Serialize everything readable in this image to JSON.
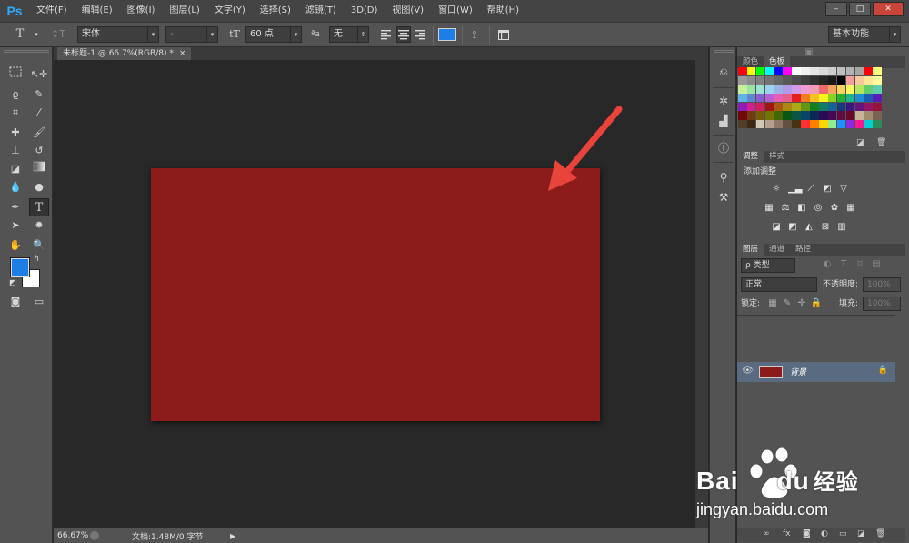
{
  "app": {
    "logo": "Ps"
  },
  "menu": [
    "文件(F)",
    "编辑(E)",
    "图像(I)",
    "图层(L)",
    "文字(Y)",
    "选择(S)",
    "滤镜(T)",
    "3D(D)",
    "视图(V)",
    "窗口(W)",
    "帮助(H)"
  ],
  "window_controls": {
    "minimize": "–",
    "maximize": "□",
    "close": "✕"
  },
  "options": {
    "tool_glyph": "T",
    "font_family": "宋体",
    "font_style": "-",
    "font_size": "60 点",
    "aa_label": "ªa",
    "antialias": "无",
    "text_color": "#1e7ee6",
    "workspace": "基本功能"
  },
  "document": {
    "tab_title": "未标题-1 @ 66.7%(RGB/8) *",
    "tab_close": "×",
    "canvas_color": "#8c1c1c",
    "arrow_color": "#e8443c"
  },
  "status": {
    "zoom": "66.67%",
    "doc_info": "文档:1.48M/0 字节"
  },
  "colors": {
    "foreground": "#1e7ee6",
    "background": "#ffffff"
  },
  "panels": {
    "swatch_tabs": [
      "颜色",
      "色板"
    ],
    "adjust_tabs": [
      "调整",
      "样式"
    ],
    "adjust_title": "添加调整",
    "layer_tabs": [
      "图层",
      "通道",
      "路径"
    ],
    "filter_kind": "ρ 类型",
    "blend_mode": "正常",
    "opacity_label": "不透明度:",
    "opacity_value": "100%",
    "lock_label": "锁定:",
    "fill_label": "填充:",
    "fill_value": "100%",
    "layer_name": "背景",
    "layer_color": "#8c1c1c"
  },
  "swatches": [
    "#ff0000",
    "#ffff00",
    "#00ff00",
    "#00ffff",
    "#0000ff",
    "#ff00ff",
    "#ffffff",
    "#f2f2f2",
    "#e6e6e6",
    "#d9d9d9",
    "#cccccc",
    "#bfbfbf",
    "#b3b3b3",
    "#a6a6a6",
    "#ff0000",
    "#ffff80",
    "#999999",
    "#8c8c8c",
    "#808080",
    "#737373",
    "#666666",
    "#595959",
    "#4d4d4d",
    "#404040",
    "#333333",
    "#262626",
    "#1a1a1a",
    "#000000",
    "#f4a0a0",
    "#f8c89a",
    "#fde59a",
    "#fdfc9a",
    "#c8f09a",
    "#9ae6a0",
    "#9ae6d2",
    "#9ad2f0",
    "#9ab4e6",
    "#b49ae6",
    "#d29ae6",
    "#f09ad2",
    "#f09ab4",
    "#ed6b6b",
    "#f4a65f",
    "#fbd15f",
    "#fbf95f",
    "#b4e65f",
    "#5fcd6b",
    "#5fcdb4",
    "#5fb4e6",
    "#5f87d2",
    "#875fd2",
    "#b45fd2",
    "#e65fb4",
    "#e65f87",
    "#e61e1e",
    "#ef7d1e",
    "#f7c11e",
    "#f7f41e",
    "#8dd21e",
    "#1eb42d",
    "#1eb48d",
    "#1e8dd2",
    "#1e5ab4",
    "#5a1eb4",
    "#8d1eb4",
    "#d21e8d",
    "#d21e5a",
    "#a01414",
    "#a85a14",
    "#ad8714",
    "#ada914",
    "#649614",
    "#147d1e",
    "#147d64",
    "#146496",
    "#143c7d",
    "#3c147d",
    "#64147d",
    "#961464",
    "#96143c",
    "#6e0a0a",
    "#733c0a",
    "#765c0a",
    "#767400",
    "#446605",
    "#0a5514",
    "#0a5544",
    "#0a4466",
    "#0a2855",
    "#280a55",
    "#440a55",
    "#660a44",
    "#660a28",
    "#c8b496",
    "#a08c6e",
    "#786450",
    "#503c28",
    "#3c2814",
    "#d2c8b4",
    "#b4a08c",
    "#8c7864",
    "#645040",
    "#463214",
    "#ff3030",
    "#ff8000",
    "#ffd700",
    "#90ee90",
    "#1e90ff",
    "#8a2be2",
    "#ff1493",
    "#00ced1",
    "#2e8b57"
  ],
  "watermark": {
    "brand_a": "Bai",
    "brand_b": "du",
    "brand_c": "经验",
    "url": "jingyan.baidu.com"
  }
}
